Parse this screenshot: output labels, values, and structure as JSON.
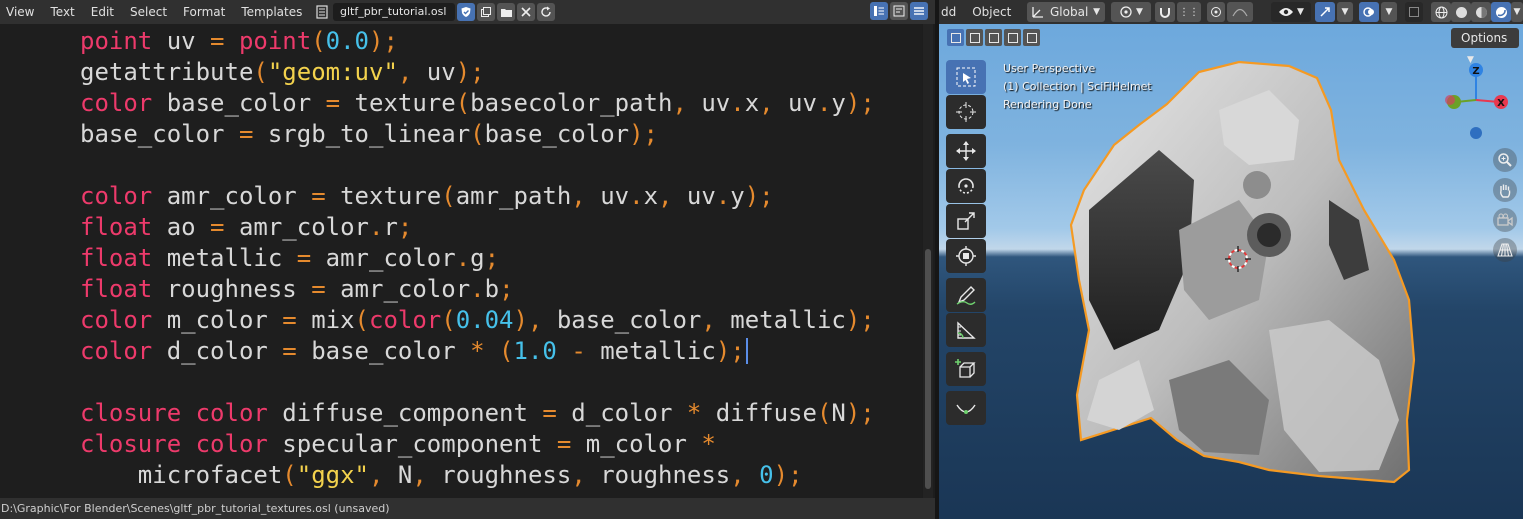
{
  "text_editor": {
    "menus": [
      "View",
      "Text",
      "Edit",
      "Select",
      "Format",
      "Templates"
    ],
    "file_name": "gltf_pbr_tutorial.osl",
    "status_path": "D:\\Graphic\\For Blender\\Scenes\\gltf_pbr_tutorial_textures.osl (unsaved)",
    "code_lines": [
      [
        [
          "kw",
          "point"
        ],
        [
          "txt",
          " uv "
        ],
        [
          "op",
          "="
        ],
        [
          "txt",
          " "
        ],
        [
          "kw",
          "point"
        ],
        [
          "op",
          "("
        ],
        [
          "num",
          "0.0"
        ],
        [
          "op",
          ");"
        ]
      ],
      [
        [
          "txt",
          "getattribute"
        ],
        [
          "op",
          "("
        ],
        [
          "str",
          "\"geom:uv\""
        ],
        [
          "op",
          ","
        ],
        [
          "txt",
          " uv"
        ],
        [
          "op",
          ");"
        ]
      ],
      [
        [
          "kw",
          "color"
        ],
        [
          "txt",
          " base_color "
        ],
        [
          "op",
          "="
        ],
        [
          "txt",
          " texture"
        ],
        [
          "op",
          "("
        ],
        [
          "txt",
          "basecolor_path"
        ],
        [
          "op",
          ","
        ],
        [
          "txt",
          " uv"
        ],
        [
          "op",
          "."
        ],
        [
          "txt",
          "x"
        ],
        [
          "op",
          ","
        ],
        [
          "txt",
          " uv"
        ],
        [
          "op",
          "."
        ],
        [
          "txt",
          "y"
        ],
        [
          "op",
          ");"
        ]
      ],
      [
        [
          "txt",
          "base_color "
        ],
        [
          "op",
          "="
        ],
        [
          "txt",
          " srgb_to_linear"
        ],
        [
          "op",
          "("
        ],
        [
          "txt",
          "base_color"
        ],
        [
          "op",
          ");"
        ]
      ],
      [],
      [
        [
          "kw",
          "color"
        ],
        [
          "txt",
          " amr_color "
        ],
        [
          "op",
          "="
        ],
        [
          "txt",
          " texture"
        ],
        [
          "op",
          "("
        ],
        [
          "txt",
          "amr_path"
        ],
        [
          "op",
          ","
        ],
        [
          "txt",
          " uv"
        ],
        [
          "op",
          "."
        ],
        [
          "txt",
          "x"
        ],
        [
          "op",
          ","
        ],
        [
          "txt",
          " uv"
        ],
        [
          "op",
          "."
        ],
        [
          "txt",
          "y"
        ],
        [
          "op",
          ");"
        ]
      ],
      [
        [
          "kw",
          "float"
        ],
        [
          "txt",
          " ao "
        ],
        [
          "op",
          "="
        ],
        [
          "txt",
          " amr_color"
        ],
        [
          "op",
          "."
        ],
        [
          "txt",
          "r"
        ],
        [
          "op",
          ";"
        ]
      ],
      [
        [
          "kw",
          "float"
        ],
        [
          "txt",
          " metallic "
        ],
        [
          "op",
          "="
        ],
        [
          "txt",
          " amr_color"
        ],
        [
          "op",
          "."
        ],
        [
          "txt",
          "g"
        ],
        [
          "op",
          ";"
        ]
      ],
      [
        [
          "kw",
          "float"
        ],
        [
          "txt",
          " roughness "
        ],
        [
          "op",
          "="
        ],
        [
          "txt",
          " amr_color"
        ],
        [
          "op",
          "."
        ],
        [
          "txt",
          "b"
        ],
        [
          "op",
          ";"
        ]
      ],
      [
        [
          "kw",
          "color"
        ],
        [
          "txt",
          " m_color "
        ],
        [
          "op",
          "="
        ],
        [
          "txt",
          " mix"
        ],
        [
          "op",
          "("
        ],
        [
          "kw",
          "color"
        ],
        [
          "op",
          "("
        ],
        [
          "num",
          "0.04"
        ],
        [
          "op",
          "),"
        ],
        [
          "txt",
          " base_color"
        ],
        [
          "op",
          ","
        ],
        [
          "txt",
          " metallic"
        ],
        [
          "op",
          ");"
        ]
      ],
      [
        [
          "kw",
          "color"
        ],
        [
          "txt",
          " d_color "
        ],
        [
          "op",
          "="
        ],
        [
          "txt",
          " base_color "
        ],
        [
          "op",
          "*"
        ],
        [
          "txt",
          " "
        ],
        [
          "op",
          "("
        ],
        [
          "num",
          "1.0"
        ],
        [
          "txt",
          " "
        ],
        [
          "op",
          "-"
        ],
        [
          "txt",
          " metallic"
        ],
        [
          "op",
          ");"
        ]
      ],
      [],
      [
        [
          "kw",
          "closure"
        ],
        [
          "txt",
          " "
        ],
        [
          "kw",
          "color"
        ],
        [
          "txt",
          " diffuse_component "
        ],
        [
          "op",
          "="
        ],
        [
          "txt",
          " d_color "
        ],
        [
          "op",
          "*"
        ],
        [
          "txt",
          " diffuse"
        ],
        [
          "op",
          "("
        ],
        [
          "txt",
          "N"
        ],
        [
          "op",
          ");"
        ]
      ],
      [
        [
          "kw",
          "closure"
        ],
        [
          "txt",
          " "
        ],
        [
          "kw",
          "color"
        ],
        [
          "txt",
          " specular_component "
        ],
        [
          "op",
          "="
        ],
        [
          "txt",
          " m_color "
        ],
        [
          "op",
          "*"
        ]
      ],
      [
        [
          "txt",
          "    microfacet"
        ],
        [
          "op",
          "("
        ],
        [
          "str",
          "\"ggx\""
        ],
        [
          "op",
          ","
        ],
        [
          "txt",
          " N"
        ],
        [
          "op",
          ","
        ],
        [
          "txt",
          " roughness"
        ],
        [
          "op",
          ","
        ],
        [
          "txt",
          " roughness"
        ],
        [
          "op",
          ","
        ],
        [
          "txt",
          " "
        ],
        [
          "num",
          "0"
        ],
        [
          "op",
          ");"
        ]
      ]
    ]
  },
  "viewport": {
    "menus": [
      "dd",
      "Object"
    ],
    "orientation": "Global",
    "options_label": "Options",
    "overlay": {
      "line1": "User Perspective",
      "line2": "(1) Collection | SciFiHelmet",
      "line3": "Rendering Done"
    },
    "gizmo": {
      "z_label": "Z",
      "x_label": "X"
    },
    "colors": {
      "accent": "#4772b3",
      "selection_outline": "#f59a23",
      "axis_x": "#e8384f",
      "axis_y": "#6ba127",
      "axis_z": "#2f83e3"
    }
  }
}
